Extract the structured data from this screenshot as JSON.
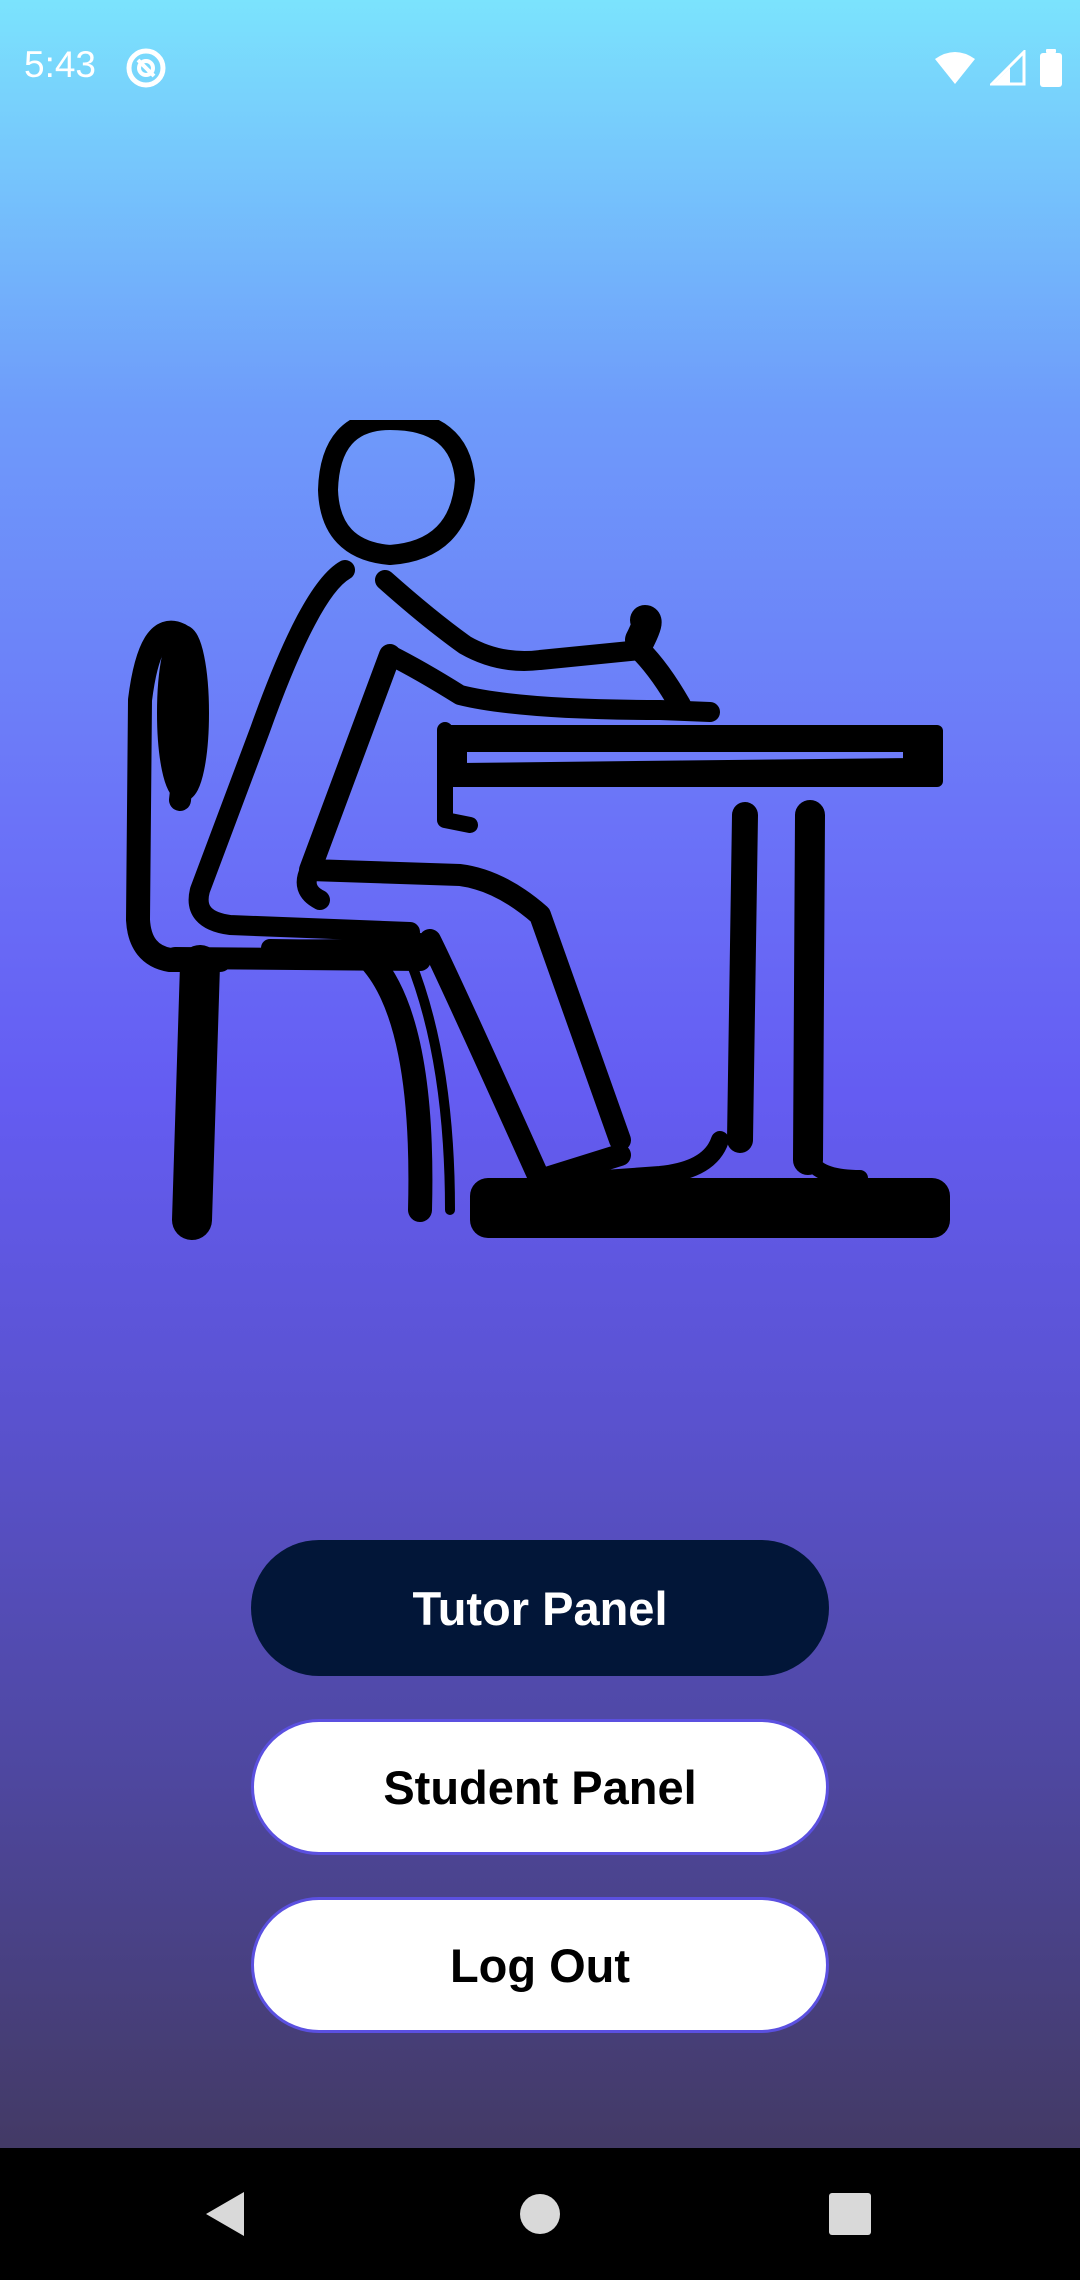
{
  "status_bar": {
    "time": "5:43",
    "app_icon": "at-sign-icon",
    "icons": [
      "wifi-icon",
      "cell-signal-icon",
      "battery-icon"
    ]
  },
  "illustration": {
    "icon": "student-at-desk-icon"
  },
  "buttons": {
    "tutor_panel": "Tutor Panel",
    "student_panel": "Student Panel",
    "log_out": "Log Out"
  },
  "navigation": {
    "icons": [
      "back-icon",
      "home-icon",
      "recents-icon"
    ]
  },
  "colors": {
    "gradient_top": "#7BE3FD",
    "gradient_mid": "#645CF2",
    "gradient_bottom": "#433A66",
    "primary_button": "#021638",
    "button_border": "#5B50E0"
  }
}
